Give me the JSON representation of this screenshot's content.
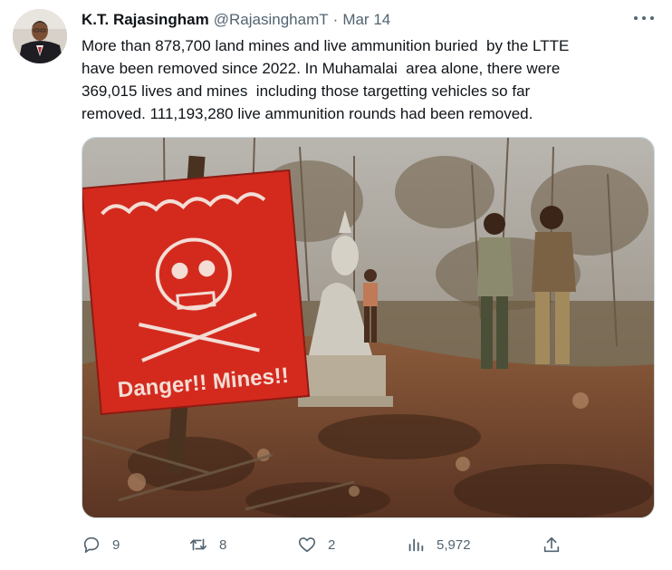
{
  "author": {
    "display_name": "K.T. Rajasingham",
    "handle": "@RajasinghamT",
    "separator": "·",
    "date": "Mar 14"
  },
  "tweet": {
    "lines": [
      "More than 878,700 land mines and live ammunition buried  by the LTTE",
      "have been removed since 2022. In Muhamalai  area alone, there were",
      "369,015 lives and mines  including those targetting vehicles so far",
      "removed. 111,193,280 live ammunition rounds had been removed."
    ]
  },
  "media": {
    "sign_text": "Danger!! Mines!!",
    "sign_color": "#d42a1e"
  },
  "actions": {
    "replies": "9",
    "retweets": "8",
    "likes": "2",
    "views": "5,972"
  },
  "icons": [
    "more-icon",
    "reply-icon",
    "retweet-icon",
    "like-icon",
    "views-icon",
    "share-icon"
  ],
  "colors": {
    "text": "#0f1419",
    "muted": "#536471"
  }
}
